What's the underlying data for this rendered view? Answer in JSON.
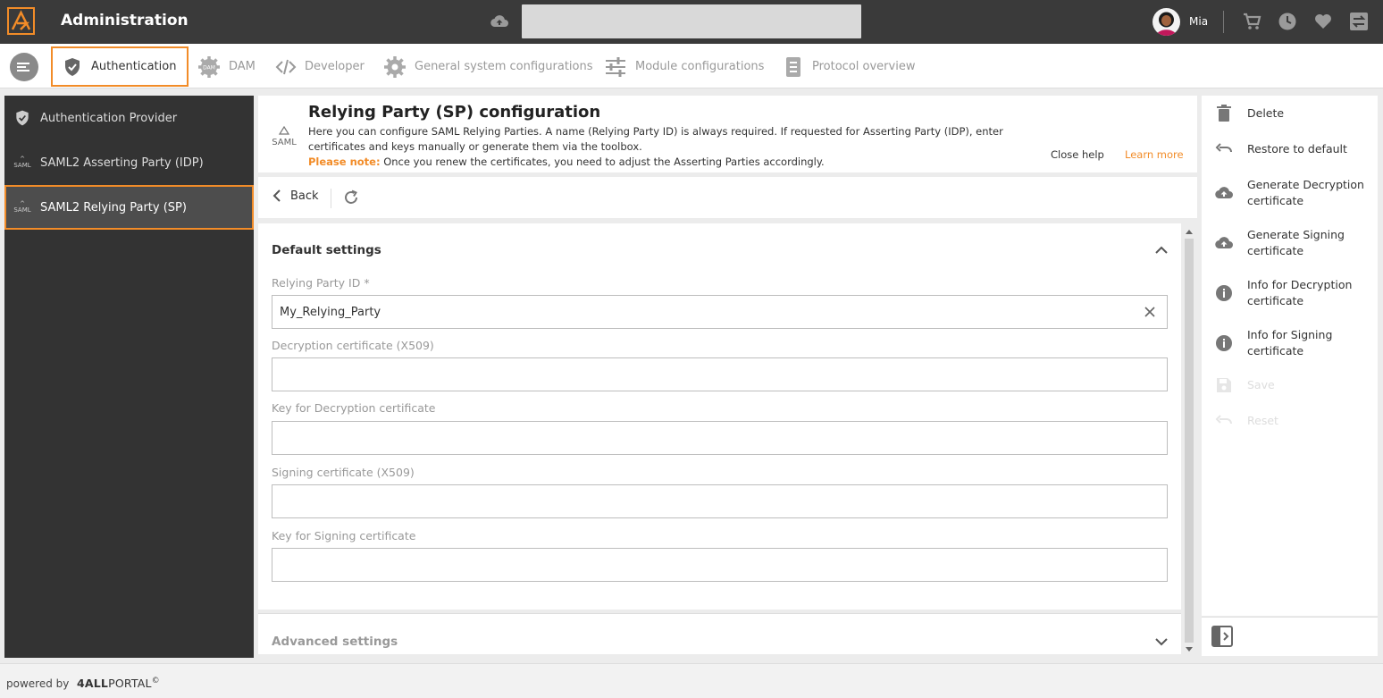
{
  "header": {
    "title": "Administration",
    "user": {
      "name": "Mia"
    },
    "search": {
      "placeholder": ""
    }
  },
  "nav": {
    "tabs": [
      {
        "label": "Authentication",
        "icon": "shield-check-icon",
        "active": true
      },
      {
        "label": "DAM",
        "icon": "dam-gear-icon",
        "active": false
      },
      {
        "label": "Developer",
        "icon": "code-icon",
        "active": false
      },
      {
        "label": "General system configurations",
        "icon": "gear-icon",
        "active": false
      },
      {
        "label": "Module configurations",
        "icon": "sliders-icon",
        "active": false
      },
      {
        "label": "Protocol overview",
        "icon": "document-icon",
        "active": false
      }
    ]
  },
  "sidebar": {
    "items": [
      {
        "label": "Authentication Provider",
        "icon": "shield-check-icon",
        "active": false
      },
      {
        "label": "SAML2 Asserting Party (IDP)",
        "icon": "saml-icon",
        "active": false
      },
      {
        "label": "SAML2 Relying Party (SP)",
        "icon": "saml-icon",
        "active": true
      }
    ]
  },
  "help": {
    "logo_text": "SAML",
    "title": "Relying Party (SP) configuration",
    "text": "Here you can configure SAML Relying Parties. A name (Relying Party ID) is always required. If requested for Asserting Party (IDP), enter certificates and keys manually or generate them via the toolbox.",
    "note_label": "Please note:",
    "note_text": " Once you renew the certificates, you need to adjust the Asserting Parties accordingly.",
    "close_label": "Close help",
    "learn_more_label": "Learn more"
  },
  "toolbar": {
    "back_label": "Back"
  },
  "form": {
    "section_title": "Default settings",
    "fields": [
      {
        "label": "Relying Party ID *",
        "value": "My_Relying_Party"
      },
      {
        "label": "Decryption certificate (X509)",
        "value": ""
      },
      {
        "label": "Key for Decryption certificate",
        "value": ""
      },
      {
        "label": "Signing certificate (X509)",
        "value": ""
      },
      {
        "label": "Key for Signing certificate",
        "value": ""
      }
    ],
    "advanced_title": "Advanced settings"
  },
  "actions": [
    {
      "label": "Delete",
      "icon": "trash-icon",
      "enabled": true
    },
    {
      "label": "Restore to default",
      "icon": "undo-icon",
      "enabled": true
    },
    {
      "label": "Generate Decryption certificate",
      "icon": "cloud-upload-icon",
      "enabled": true
    },
    {
      "label": "Generate Signing certificate",
      "icon": "cloud-upload-icon",
      "enabled": true
    },
    {
      "label": "Info for Decryption certificate",
      "icon": "info-icon",
      "enabled": true
    },
    {
      "label": "Info for Signing certificate",
      "icon": "info-icon",
      "enabled": true
    },
    {
      "label": "Save",
      "icon": "save-icon",
      "enabled": false
    },
    {
      "label": "Reset",
      "icon": "undo-icon",
      "enabled": false
    }
  ],
  "footer": {
    "powered_by": "powered by",
    "brand_bold": "4ALL",
    "brand_rest": "PORTAL",
    "brand_mark": "©"
  },
  "colors": {
    "accent": "#f28c28",
    "topbar": "#3a3a3a",
    "sidebar": "#333333"
  }
}
